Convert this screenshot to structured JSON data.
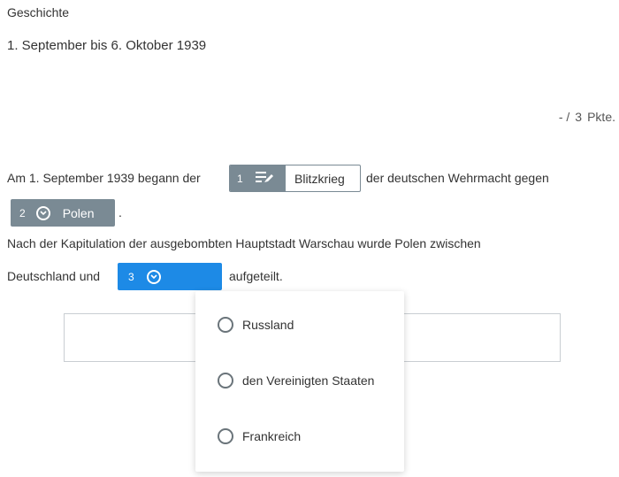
{
  "header": {
    "subject": "Geschichte",
    "topic": "1. September bis 6. Oktober 1939",
    "points_value": "- /",
    "points_max": "3",
    "points_unit": "Pkte."
  },
  "question": {
    "sentence1_before": "Am 1. September 1939 begann der",
    "sentence1_after": "der deutschen Wehrmacht gegen",
    "sentence1_end": ".",
    "sentence2_line1": "Nach der Kapitulation der ausgebombten Hauptstadt Warschau wurde Polen zwischen",
    "sentence2_before": "Deutschland und",
    "sentence2_after": "aufgeteilt."
  },
  "gaps": [
    {
      "number": "1",
      "type": "text-input",
      "icon": "text-edit-icon",
      "value": "Blitzkrieg"
    },
    {
      "number": "2",
      "type": "dropdown",
      "icon": "chevron-circle-icon",
      "value": "Polen"
    },
    {
      "number": "3",
      "type": "dropdown",
      "icon": "chevron-circle-icon",
      "value": "",
      "state": "open"
    }
  ],
  "dropdown_options": [
    {
      "label": "Russland",
      "selected": false
    },
    {
      "label": "den Vereinigten Staaten",
      "selected": false
    },
    {
      "label": "Frankreich",
      "selected": false
    }
  ],
  "colors": {
    "filled_badge": "#7a8a94",
    "active_gap": "#1d8ae6"
  }
}
